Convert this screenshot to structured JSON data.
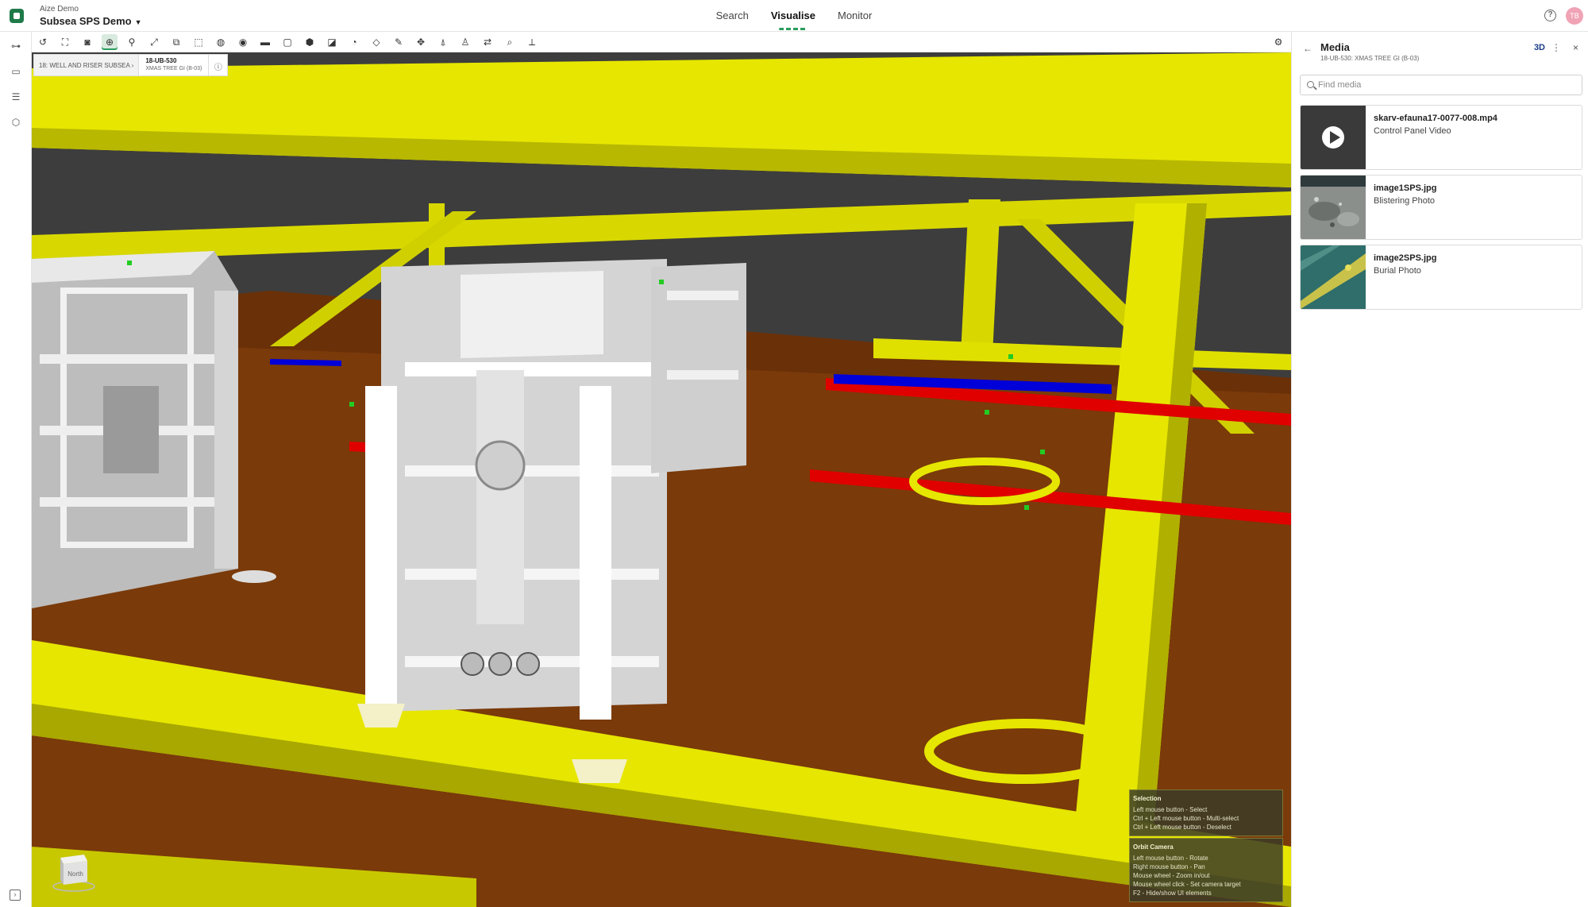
{
  "header": {
    "org": "Aize Demo",
    "project": "Subsea SPS Demo",
    "nav": [
      {
        "label": "Search",
        "active": false
      },
      {
        "label": "Visualise",
        "active": true
      },
      {
        "label": "Monitor",
        "active": false
      }
    ],
    "user_initials": "TB"
  },
  "breadcrumb": {
    "parent": "18: WELL AND RISER SUBSEA",
    "current_tag": "18-UB-530",
    "current_name": "XMAS TREE GI (B-03)"
  },
  "hints": [
    {
      "title": "Selection",
      "lines": [
        "Left mouse button - Select",
        "Ctrl + Left mouse button - Multi-select",
        "Ctrl + Left mouse button - Deselect"
      ]
    },
    {
      "title": "Orbit Camera",
      "lines": [
        "Left mouse button - Rotate",
        "Right mouse button - Pan",
        "Mouse wheel - Zoom in/out",
        "Mouse wheel click - Set camera target",
        "F2 - Hide/show UI elements"
      ]
    }
  ],
  "navcube": {
    "face_label": "North"
  },
  "panel": {
    "title": "Media",
    "subtitle": "18-UB-530: XMAS TREE GI (B-03)",
    "mode_button": "3D",
    "search_placeholder": "Find media",
    "items": [
      {
        "name": "skarv-efauna17-0077-008.mp4",
        "description": "Control Panel Video",
        "type": "video"
      },
      {
        "name": "image1SPS.jpg",
        "description": "Blistering Photo",
        "type": "image"
      },
      {
        "name": "image2SPS.jpg",
        "description": "Burial Photo",
        "type": "image"
      }
    ]
  },
  "colors": {
    "accent": "#2a9d5c",
    "structure_yellow": "#e6e600",
    "seabed": "#7a3a0a",
    "pipe_red": "#e00000",
    "pipe_blue": "#0000d8"
  }
}
